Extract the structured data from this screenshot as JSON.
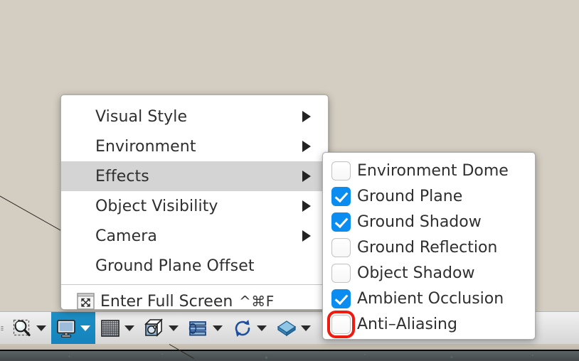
{
  "app": {
    "background_color": "#d4cec2",
    "accent_checkbox_color": "#0a8cf0",
    "annotation_color": "#ee1b11",
    "toolbar_active_color": "#1583bd"
  },
  "context_menu": {
    "items": [
      {
        "label": "Visual Style",
        "has_submenu": true,
        "highlighted": false
      },
      {
        "label": "Environment",
        "has_submenu": true,
        "highlighted": false
      },
      {
        "label": "Effects",
        "has_submenu": true,
        "highlighted": true
      },
      {
        "label": "Object Visibility",
        "has_submenu": true,
        "highlighted": false
      },
      {
        "label": "Camera",
        "has_submenu": true,
        "highlighted": false
      },
      {
        "label": "Ground Plane Offset",
        "has_submenu": false,
        "highlighted": false
      }
    ],
    "full_screen": {
      "label": "Enter Full Screen",
      "shortcut": "^⌘F",
      "icon": "fullscreen-icon"
    }
  },
  "effects_submenu": {
    "items": [
      {
        "label": "Environment Dome",
        "checked": false,
        "annotated": false
      },
      {
        "label": "Ground Plane",
        "checked": true,
        "annotated": false
      },
      {
        "label": "Ground Shadow",
        "checked": true,
        "annotated": false
      },
      {
        "label": "Ground Reflection",
        "checked": false,
        "annotated": false
      },
      {
        "label": "Object Shadow",
        "checked": false,
        "annotated": false
      },
      {
        "label": "Ambient Occlusion",
        "checked": true,
        "annotated": false
      },
      {
        "label": "Anti–Aliasing",
        "checked": false,
        "annotated": true
      }
    ]
  },
  "toolbar": {
    "items": [
      {
        "name": "zoom-to-selection-tool",
        "icon": "magnifier-icon",
        "active": false,
        "has_caret": true
      },
      {
        "name": "display-mode-tool",
        "icon": "monitor-icon",
        "active": true,
        "has_caret": true
      },
      {
        "name": "grid-tool",
        "icon": "grid-icon",
        "active": false,
        "has_caret": true
      },
      {
        "name": "bounding-box-tool",
        "icon": "cube-sphere-icon",
        "active": false,
        "has_caret": true
      },
      {
        "name": "section-tool",
        "icon": "sections-icon",
        "active": false,
        "has_caret": true
      },
      {
        "name": "rotate-tool",
        "icon": "refresh-icon",
        "active": false,
        "has_caret": true
      },
      {
        "name": "layers-tool",
        "icon": "layer-stack-icon",
        "active": false,
        "has_caret": true
      }
    ]
  }
}
